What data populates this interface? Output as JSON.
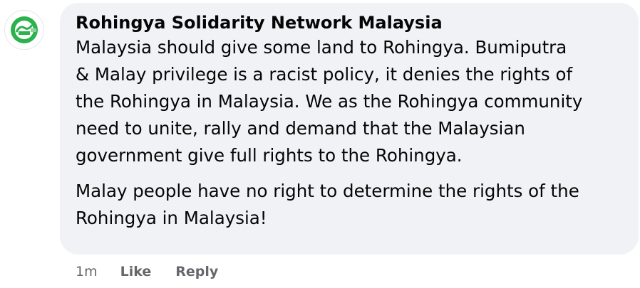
{
  "comment": {
    "author": "Rohingya Solidarity Network Malaysia",
    "avatar_icon": "organization-logo-icon",
    "paragraphs": [
      [
        "Malaysia should give some land to Rohingya. Bumiputra",
        "& Malay privilege is a racist policy, it denies the rights of",
        "the Rohingya in Malaysia. We as the Rohingya community",
        "need to unite, rally and demand that the Malaysian",
        "government give full rights to the Rohingya."
      ],
      [
        "Malay people have no right to determine the rights of the",
        "Rohingya in Malaysia!"
      ]
    ]
  },
  "actions": {
    "time": "1m",
    "like_label": "Like",
    "reply_label": "Reply"
  },
  "colors": {
    "bubble_background": "#f0f2f5",
    "text": "#050505",
    "secondary_text": "#65676b",
    "logo_green": "#2bb24c"
  }
}
